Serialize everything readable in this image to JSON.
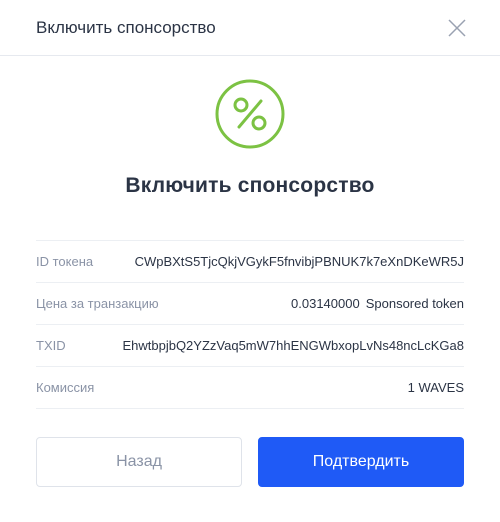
{
  "header": {
    "title": "Включить спонсорство",
    "close_icon": "close-icon"
  },
  "hero": {
    "title": "Включить спонсорство",
    "icon": "percent-icon",
    "icon_color": "#7cc243"
  },
  "details": [
    {
      "label": "ID токена",
      "value": "CWpBXtS5TjcQkjVGykF5fnvibjPBNUK7k7eXnDKeWR5J"
    },
    {
      "label": "Цена за транзакцию",
      "value": "0.03140000",
      "value_suffix": "Sponsored token"
    },
    {
      "label": "TXID",
      "value": "EhwtbpjbQ2YZzVaq5mW7hhENGWbxopLvNs48ncLcKGa8"
    },
    {
      "label": "Комиссия",
      "value": "1 WAVES"
    }
  ],
  "actions": {
    "back_label": "Назад",
    "confirm_label": "Подтвердить"
  },
  "colors": {
    "primary": "#1f5af6",
    "accent": "#7cc243",
    "text": "#2b3445",
    "muted": "#8a93a6"
  }
}
